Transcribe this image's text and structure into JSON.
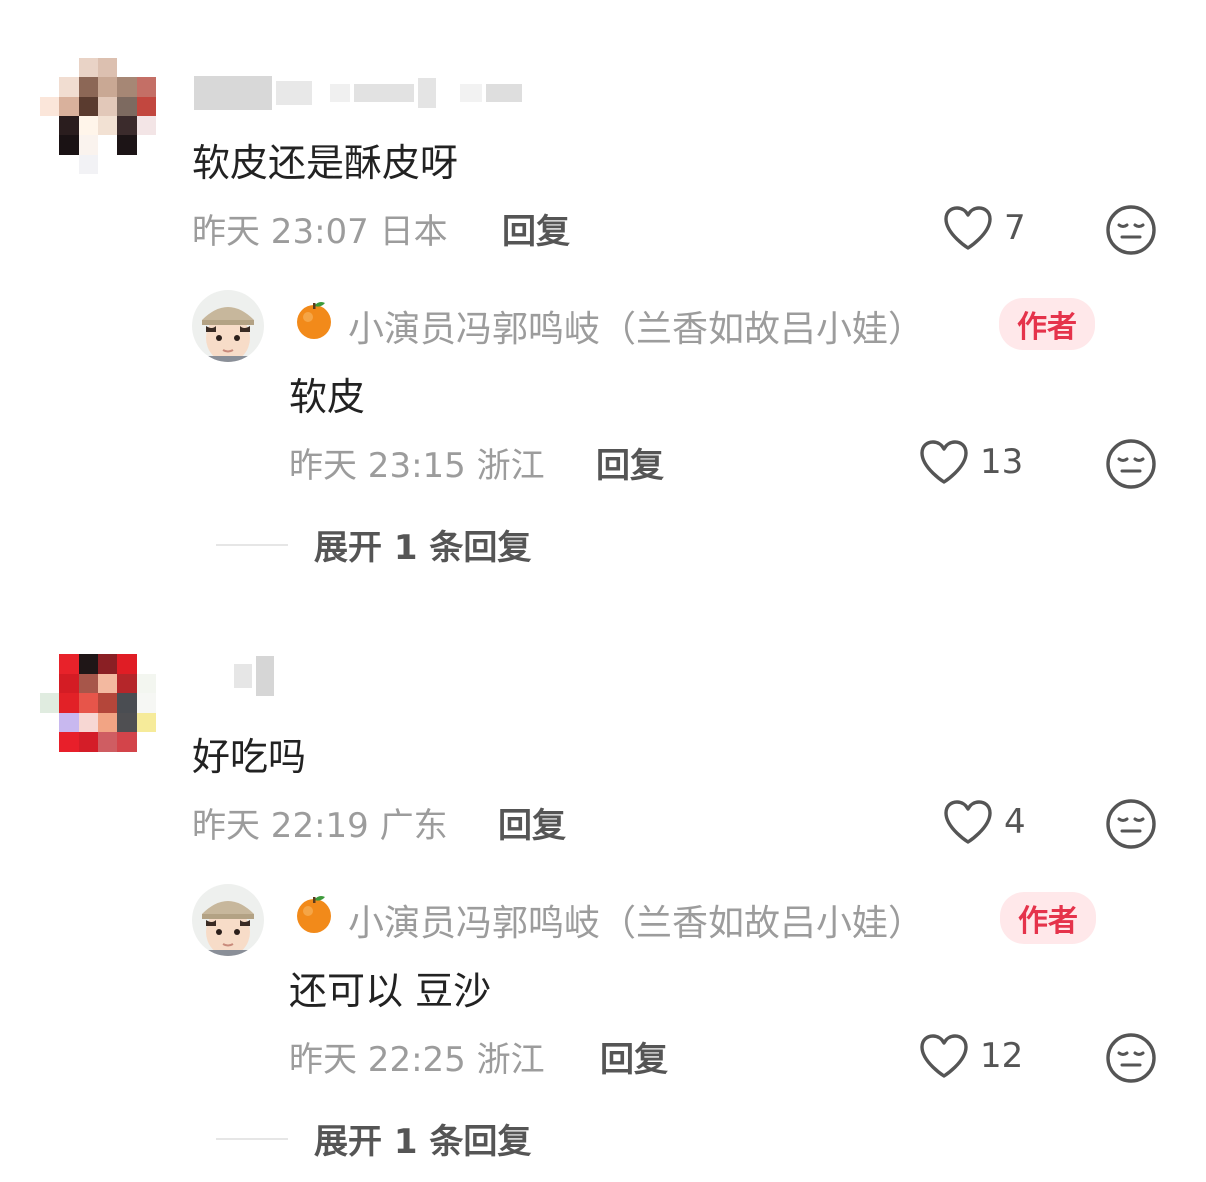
{
  "comments": [
    {
      "text": "软皮还是酥皮呀",
      "time": "昨天 23:07",
      "location": "日本",
      "reply_label": "回复",
      "likes": "7",
      "reply": {
        "author": "小演员冯郭鸣岐（兰香如故吕小娃）",
        "badge": "作者",
        "text": "软皮",
        "time": "昨天 23:15",
        "location": "浙江",
        "reply_label": "回复",
        "likes": "13"
      },
      "expand_label": "展开 1 条回复"
    },
    {
      "text": "好吃吗",
      "time": "昨天 22:19",
      "location": "广东",
      "reply_label": "回复",
      "likes": "4",
      "reply": {
        "author": "小演员冯郭鸣岐（兰香如故吕小娃）",
        "badge": "作者",
        "text": "还可以 豆沙",
        "time": "昨天 22:25",
        "location": "浙江",
        "reply_label": "回复",
        "likes": "12"
      },
      "expand_label": "展开 1 条回复"
    }
  ],
  "icons": {
    "like": "heart-outline-icon",
    "emoji": "expressionless-face-icon",
    "author_prefix": "orange-emoji-icon"
  },
  "colors": {
    "badge_bg": "#ffe8ea",
    "badge_text": "#e5334b",
    "meta_text": "#9c9c9c"
  }
}
